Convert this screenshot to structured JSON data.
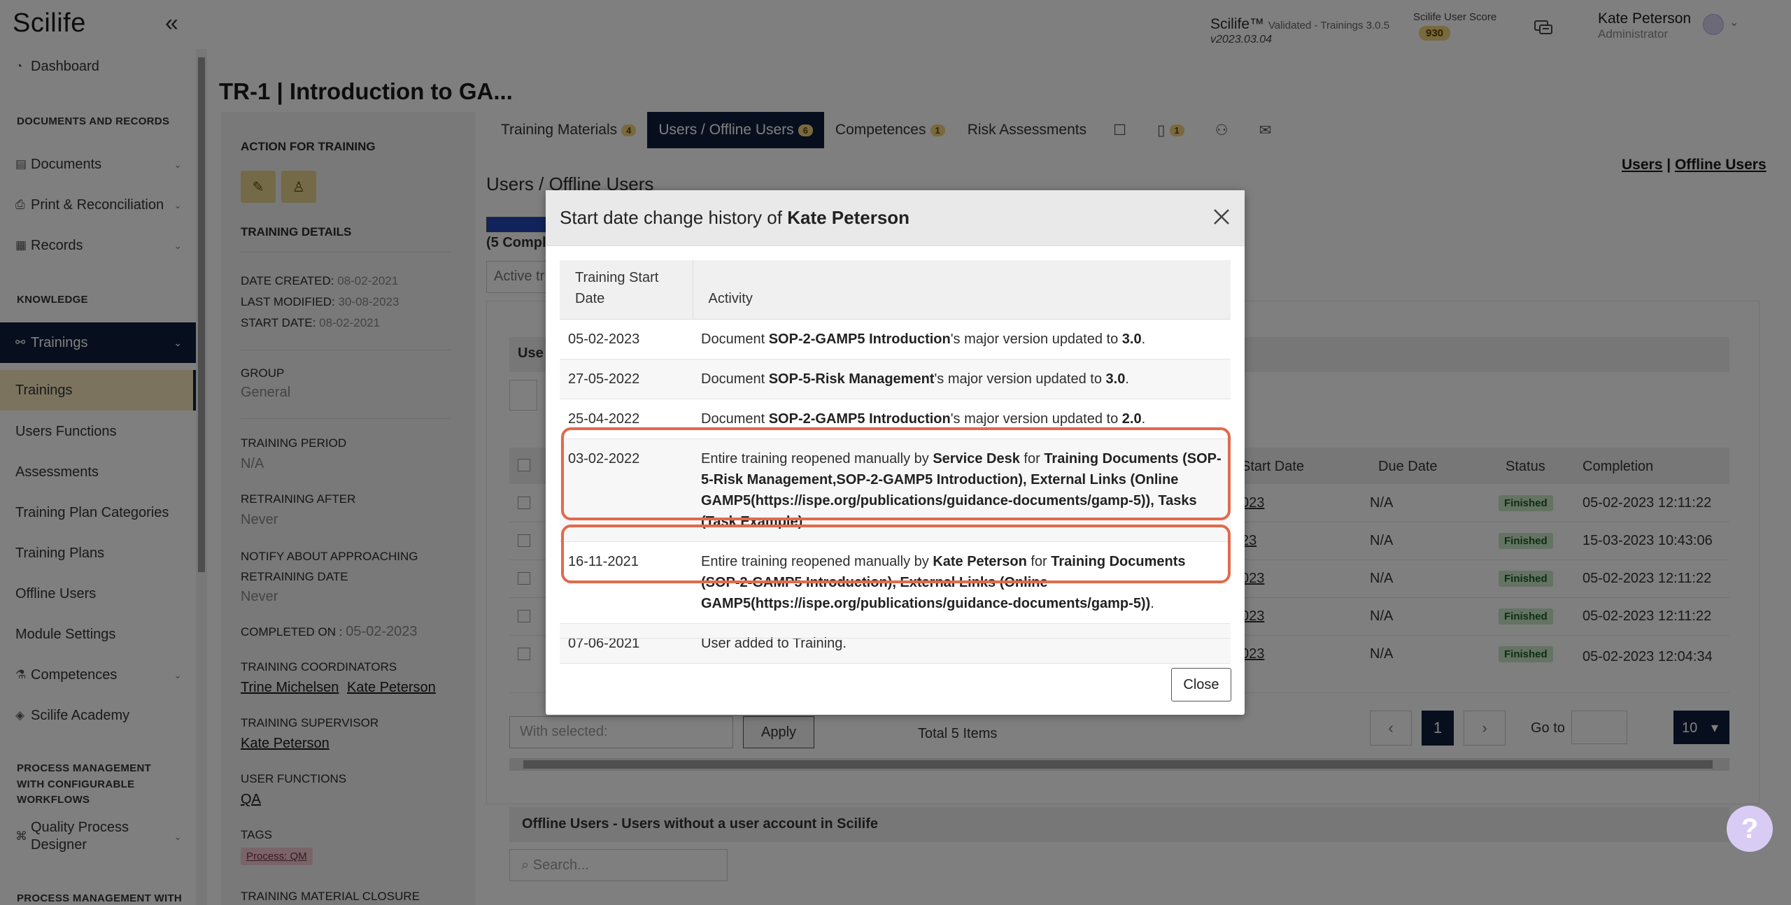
{
  "app": {
    "logo": "Scilife",
    "version_name": "Scilife™",
    "version_note": "Validated - Trainings 3.0.5",
    "version_number": "v2023.03.04",
    "score_label": "Scilife User Score",
    "score_value": "930",
    "user_name": "Kate Peterson",
    "user_role": "Administrator",
    "accent": "#0e1f3d",
    "highlight": "#e26a4c"
  },
  "sidebar": {
    "dashboard": "Dashboard",
    "section_docs": "DOCUMENTS AND RECORDS",
    "documents": "Documents",
    "print": "Print & Reconciliation",
    "records": "Records",
    "section_knowledge": "KNOWLEDGE",
    "trainings": "Trainings",
    "trainings_sub": "Trainings",
    "users_functions": "Users Functions",
    "assessments": "Assessments",
    "plan_categories": "Training Plan Categories",
    "plans": "Training Plans",
    "offline_users": "Offline Users",
    "module_settings": "Module Settings",
    "competences": "Competences",
    "academy": "Scilife Academy",
    "section_process1": "PROCESS MANAGEMENT WITH CONFIGURABLE WORKFLOWS",
    "quality_designer": "Quality Process Designer",
    "section_process2": "PROCESS MANAGEMENT WITH"
  },
  "page": {
    "title": "TR-1 | Introduction to GA...",
    "action_label": "ACTION FOR TRAINING",
    "details_label": "TRAINING DETAILS",
    "date_created_label": "DATE CREATED:",
    "date_created": "08-02-2021",
    "last_modified_label": "LAST MODIFIED:",
    "last_modified": "30-08-2023",
    "start_date_label": "START DATE:",
    "start_date": "08-02-2021",
    "group_label": "GROUP",
    "group": "General",
    "period_label": "TRAINING PERIOD",
    "period": "N/A",
    "retraining_label": "RETRAINING AFTER",
    "retraining": "Never",
    "notify_label": "NOTIFY ABOUT APPROACHING RETRAINING DATE",
    "notify": "Never",
    "completed_label": "COMPLETED ON :",
    "completed": "05-02-2023",
    "coordinators_label": "TRAINING COORDINATORS",
    "coordinator_1": "Trine Michelsen",
    "coordinator_2": "Kate Peterson",
    "supervisor_label": "TRAINING SUPERVISOR",
    "supervisor": "Kate Peterson",
    "functions_label": "USER FUNCTIONS",
    "functions": "QA",
    "tags_label": "TAGS",
    "tag": "Process: QM",
    "closure_label": "TRAINING MATERIAL CLOSURE"
  },
  "tabs": [
    {
      "label": "Training Materials",
      "badge": "4"
    },
    {
      "label": "Users / Offline Users",
      "badge": "6"
    },
    {
      "label": "Competences",
      "badge": "1"
    },
    {
      "label": "Risk Assessments",
      "badge": ""
    }
  ],
  "tab_icons": {
    "doc_badge": "1"
  },
  "users": {
    "section_title": "Users / Offline Users",
    "link_users": "Users",
    "link_offline": "Offline Users",
    "progress_label": "(5 Compl",
    "active_filter": "Active tr",
    "panel_title": "Use",
    "search_prefix": "S",
    "col_start": "Start Date",
    "col_due": "Due Date",
    "col_status": "Status",
    "col_completion": "Completion",
    "rows": [
      {
        "start": "023",
        "due": "N/A",
        "status": "Finished",
        "completion": "05-02-2023 12:11:22"
      },
      {
        "start": "23",
        "due": "N/A",
        "status": "Finished",
        "completion": "15-03-2023 10:43:06"
      },
      {
        "start": "023",
        "due": "N/A",
        "status": "Finished",
        "completion": "05-02-2023 12:11:22"
      },
      {
        "start": "023",
        "due": "N/A",
        "status": "Finished",
        "completion": "05-02-2023 12:11:22"
      },
      {
        "start": "023",
        "due": "N/A",
        "status": "Finished",
        "completion": "05-02-2023 12:04:34"
      }
    ],
    "with_selected": "With selected:",
    "apply": "Apply",
    "total": "Total 5 Items",
    "page": "1",
    "goto": "Go to",
    "per_page": "10",
    "offline_title": "Offline Users - Users without a user account in Scilife",
    "offline_search": "Search..."
  },
  "modal": {
    "title_prefix": "Start date change history of",
    "title_name": "Kate Peterson",
    "col_date": "Training Start Date",
    "col_activity": "Activity",
    "close": "Close",
    "rows": [
      {
        "date": "05-02-2023",
        "parts": [
          [
            "Document ",
            0
          ],
          [
            "SOP-2-GAMP5 Introduction",
            1
          ],
          [
            "'s major version updated to ",
            0
          ],
          [
            "3.0",
            1
          ],
          [
            ".",
            0
          ]
        ]
      },
      {
        "date": "27-05-2022",
        "parts": [
          [
            "Document ",
            0
          ],
          [
            "SOP-5-Risk Management",
            1
          ],
          [
            "'s major version updated to ",
            0
          ],
          [
            "3.0",
            1
          ],
          [
            ".",
            0
          ]
        ]
      },
      {
        "date": "25-04-2022",
        "parts": [
          [
            "Document ",
            0
          ],
          [
            "SOP-2-GAMP5 Introduction",
            1
          ],
          [
            "'s major version updated to ",
            0
          ],
          [
            "2.0",
            1
          ],
          [
            ".",
            0
          ]
        ]
      },
      {
        "date": "03-02-2022",
        "parts": [
          [
            "Entire training reopened manually by ",
            0
          ],
          [
            "Service Desk",
            1
          ],
          [
            " for ",
            0
          ],
          [
            "Training Documents (SOP-5-Risk Management,SOP-2-GAMP5 Introduction), External Links (Online GAMP5(https://ispe.org/publications/guidance-documents/gamp-5)), Tasks (Task Example)",
            1
          ],
          [
            ".",
            0
          ]
        ]
      },
      {
        "date": "16-11-2021",
        "parts": [
          [
            "Entire training reopened manually by ",
            0
          ],
          [
            "Kate Peterson",
            1
          ],
          [
            " for ",
            0
          ],
          [
            "Training Documents (SOP-2-GAMP5 Introduction), External Links (Online GAMP5(https://ispe.org/publications/guidance-documents/gamp-5))",
            1
          ],
          [
            ".",
            0
          ]
        ]
      },
      {
        "date": "07-06-2021",
        "parts": [
          [
            "User added to Training.",
            0
          ]
        ]
      }
    ]
  }
}
